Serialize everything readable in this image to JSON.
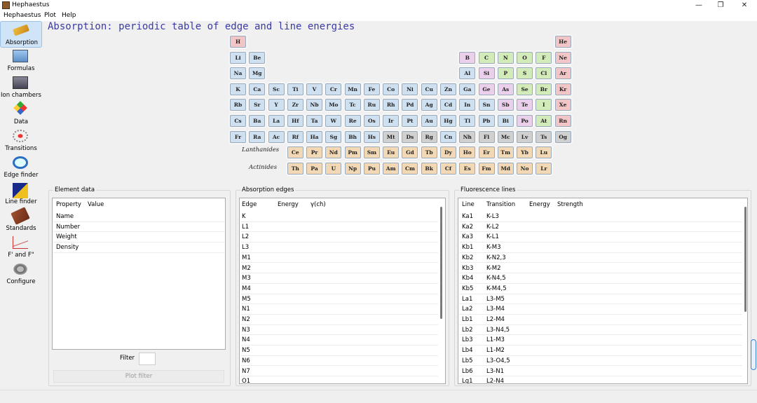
{
  "window": {
    "title": "Hephaestus",
    "minimize": "—",
    "maximize": "❐",
    "close": "✕"
  },
  "menu": [
    "Hephaestus",
    "Plot",
    "Help"
  ],
  "tools": [
    {
      "label": "Absorption",
      "icon": "absorption-icon",
      "active": true
    },
    {
      "label": "Formulas",
      "icon": "formulas-icon"
    },
    {
      "label": "Ion chambers",
      "icon": "ion-chamber-icon"
    },
    {
      "label": "Data",
      "icon": "data-icon"
    },
    {
      "label": "Transitions",
      "icon": "transitions-icon"
    },
    {
      "label": "Edge finder",
      "icon": "edge-finder-icon"
    },
    {
      "label": "Line finder",
      "icon": "line-finder-icon"
    },
    {
      "label": "Standards",
      "icon": "standards-icon"
    },
    {
      "label": "F' and F\"",
      "icon": "f-prime-icon"
    },
    {
      "label": "Configure",
      "icon": "configure-icon"
    }
  ],
  "heading": "Absorption: periodic table of edge and line energies",
  "colors": {
    "s": "#cfe0f0",
    "p_metal": "#cfe0f0",
    "d": "#cfe0f0",
    "post": "#cfe0f0",
    "metalloid": "#ead0ea",
    "nonmetal": "#d2ebb8",
    "halogen": "#d2ebb8",
    "noble": "#f2c6c6",
    "hydrogen": "#f2c6c6",
    "lanthanide": "#f2d8b4",
    "actinide": "#f2d8b4",
    "synthetic": "#d0d0d0"
  },
  "periodic_table": {
    "rows": [
      [
        [
          "H",
          "hydrogen",
          1
        ],
        [
          "He",
          "noble",
          18
        ]
      ],
      [
        [
          "Li",
          "s",
          1
        ],
        [
          "Be",
          "s",
          2
        ],
        [
          "B",
          "metalloid",
          13
        ],
        [
          "C",
          "nonmetal",
          14
        ],
        [
          "N",
          "nonmetal",
          15
        ],
        [
          "O",
          "nonmetal",
          16
        ],
        [
          "F",
          "halogen",
          17
        ],
        [
          "Ne",
          "noble",
          18
        ]
      ],
      [
        [
          "Na",
          "s",
          1
        ],
        [
          "Mg",
          "s",
          2
        ],
        [
          "Al",
          "post",
          13
        ],
        [
          "Si",
          "metalloid",
          14
        ],
        [
          "P",
          "nonmetal",
          15
        ],
        [
          "S",
          "nonmetal",
          16
        ],
        [
          "Cl",
          "halogen",
          17
        ],
        [
          "Ar",
          "noble",
          18
        ]
      ],
      [
        [
          "K",
          "s",
          1
        ],
        [
          "Ca",
          "s",
          2
        ],
        [
          "Sc",
          "d",
          3
        ],
        [
          "Ti",
          "d",
          4
        ],
        [
          "V",
          "d",
          5
        ],
        [
          "Cr",
          "d",
          6
        ],
        [
          "Mn",
          "d",
          7
        ],
        [
          "Fe",
          "d",
          8
        ],
        [
          "Co",
          "d",
          9
        ],
        [
          "Ni",
          "d",
          10
        ],
        [
          "Cu",
          "d",
          11
        ],
        [
          "Zn",
          "d",
          12
        ],
        [
          "Ga",
          "post",
          13
        ],
        [
          "Ge",
          "metalloid",
          14
        ],
        [
          "As",
          "metalloid",
          15
        ],
        [
          "Se",
          "nonmetal",
          16
        ],
        [
          "Br",
          "halogen",
          17
        ],
        [
          "Kr",
          "noble",
          18
        ]
      ],
      [
        [
          "Rb",
          "s",
          1
        ],
        [
          "Sr",
          "s",
          2
        ],
        [
          "Y",
          "d",
          3
        ],
        [
          "Zr",
          "d",
          4
        ],
        [
          "Nb",
          "d",
          5
        ],
        [
          "Mo",
          "d",
          6
        ],
        [
          "Tc",
          "d",
          7
        ],
        [
          "Ru",
          "d",
          8
        ],
        [
          "Rh",
          "d",
          9
        ],
        [
          "Pd",
          "d",
          10
        ],
        [
          "Ag",
          "d",
          11
        ],
        [
          "Cd",
          "d",
          12
        ],
        [
          "In",
          "post",
          13
        ],
        [
          "Sn",
          "post",
          14
        ],
        [
          "Sb",
          "metalloid",
          15
        ],
        [
          "Te",
          "metalloid",
          16
        ],
        [
          "I",
          "halogen",
          17
        ],
        [
          "Xe",
          "noble",
          18
        ]
      ],
      [
        [
          "Cs",
          "s",
          1
        ],
        [
          "Ba",
          "s",
          2
        ],
        [
          "La",
          "d",
          3
        ],
        [
          "Hf",
          "d",
          4
        ],
        [
          "Ta",
          "d",
          5
        ],
        [
          "W",
          "d",
          6
        ],
        [
          "Re",
          "d",
          7
        ],
        [
          "Os",
          "d",
          8
        ],
        [
          "Ir",
          "d",
          9
        ],
        [
          "Pt",
          "d",
          10
        ],
        [
          "Au",
          "d",
          11
        ],
        [
          "Hg",
          "d",
          12
        ],
        [
          "Tl",
          "post",
          13
        ],
        [
          "Pb",
          "post",
          14
        ],
        [
          "Bi",
          "post",
          15
        ],
        [
          "Po",
          "metalloid",
          16
        ],
        [
          "At",
          "halogen",
          17
        ],
        [
          "Rn",
          "noble",
          18
        ]
      ],
      [
        [
          "Fr",
          "s",
          1
        ],
        [
          "Ra",
          "s",
          2
        ],
        [
          "Ac",
          "d",
          3
        ],
        [
          "Rf",
          "d",
          4
        ],
        [
          "Ha",
          "d",
          5
        ],
        [
          "Sg",
          "d",
          6
        ],
        [
          "Bh",
          "d",
          7
        ],
        [
          "Hs",
          "d",
          8
        ],
        [
          "Mt",
          "synthetic",
          9
        ],
        [
          "Ds",
          "synthetic",
          10
        ],
        [
          "Rg",
          "synthetic",
          11
        ],
        [
          "Cn",
          "d",
          12
        ],
        [
          "Nh",
          "synthetic",
          13
        ],
        [
          "Fl",
          "synthetic",
          14
        ],
        [
          "Mc",
          "synthetic",
          15
        ],
        [
          "Lv",
          "synthetic",
          16
        ],
        [
          "Ts",
          "synthetic",
          17
        ],
        [
          "Og",
          "synthetic",
          18
        ]
      ]
    ],
    "lanthanides_label": "Lanthanides",
    "actinides_label": "Actinides",
    "lanthanides": [
      [
        "Ce",
        "lanthanide"
      ],
      [
        "Pr",
        "lanthanide"
      ],
      [
        "Nd",
        "lanthanide"
      ],
      [
        "Pm",
        "lanthanide"
      ],
      [
        "Sm",
        "lanthanide"
      ],
      [
        "Eu",
        "lanthanide"
      ],
      [
        "Gd",
        "lanthanide"
      ],
      [
        "Tb",
        "lanthanide"
      ],
      [
        "Dy",
        "lanthanide"
      ],
      [
        "Ho",
        "lanthanide"
      ],
      [
        "Er",
        "lanthanide"
      ],
      [
        "Tm",
        "lanthanide"
      ],
      [
        "Yb",
        "lanthanide"
      ],
      [
        "Lu",
        "lanthanide"
      ]
    ],
    "actinides": [
      [
        "Th",
        "actinide"
      ],
      [
        "Pa",
        "actinide"
      ],
      [
        "U",
        "actinide"
      ],
      [
        "Np",
        "actinide"
      ],
      [
        "Pu",
        "actinide"
      ],
      [
        "Am",
        "actinide"
      ],
      [
        "Cm",
        "actinide"
      ],
      [
        "Bk",
        "actinide"
      ],
      [
        "Cf",
        "actinide"
      ],
      [
        "Es",
        "actinide"
      ],
      [
        "Fm",
        "actinide"
      ],
      [
        "Md",
        "actinide"
      ],
      [
        "No",
        "actinide"
      ],
      [
        "Lr",
        "actinide"
      ]
    ]
  },
  "element_data": {
    "title": "Element data",
    "headers": [
      "Property",
      "Value"
    ],
    "rows": [
      "Name",
      "Number",
      "Weight",
      "Density"
    ]
  },
  "filter": {
    "label": "Filter",
    "button": "Plot filter"
  },
  "edges": {
    "title": "Absorption edges",
    "headers": [
      "Edge",
      "Energy",
      "γ(ch)"
    ],
    "rows": [
      "K",
      "L1",
      "L2",
      "L3",
      "M1",
      "M2",
      "M3",
      "M4",
      "M5",
      "N1",
      "N2",
      "N3",
      "N4",
      "N5",
      "N6",
      "N7",
      "O1"
    ]
  },
  "lines": {
    "title": "Fluorescence lines",
    "headers": [
      "Line",
      "Transition",
      "Energy",
      "Strength"
    ],
    "rows": [
      [
        "Ka1",
        "K-L3"
      ],
      [
        "Ka2",
        "K-L2"
      ],
      [
        "Ka3",
        "K-L1"
      ],
      [
        "Kb1",
        "K-M3"
      ],
      [
        "Kb2",
        "K-N2,3"
      ],
      [
        "Kb3",
        "K-M2"
      ],
      [
        "Kb4",
        "K-N4,5"
      ],
      [
        "Kb5",
        "K-M4,5"
      ],
      [
        "La1",
        "L3-M5"
      ],
      [
        "La2",
        "L3-M4"
      ],
      [
        "Lb1",
        "L2-M4"
      ],
      [
        "Lb2",
        "L3-N4,5"
      ],
      [
        "Lb3",
        "L1-M3"
      ],
      [
        "Lb4",
        "L1-M2"
      ],
      [
        "Lb5",
        "L3-O4,5"
      ],
      [
        "Lb6",
        "L3-N1"
      ],
      [
        "Lg1",
        "L2-N4"
      ]
    ]
  }
}
